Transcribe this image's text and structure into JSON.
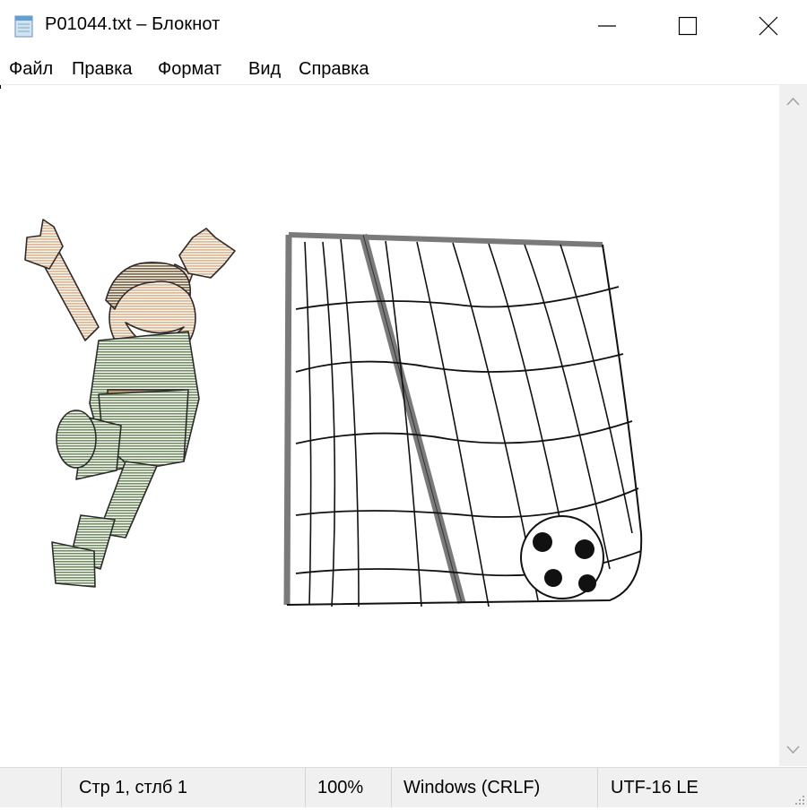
{
  "window": {
    "title": "P01044.txt – Блокнот",
    "icon": "notepad-icon",
    "controls": [
      "minimize-icon",
      "maximize-icon",
      "close-icon"
    ]
  },
  "menu": {
    "items": [
      "Файл",
      "Правка",
      "Формат",
      "Вид",
      "Справка"
    ]
  },
  "editor": {
    "content_description_icon": "ascii-art-soccer-player-and-goal"
  },
  "status": {
    "position": "Стр 1, стлб 1",
    "zoom": "100%",
    "line_endings": "Windows (CRLF)",
    "encoding": "UTF-16 LE"
  },
  "colors": {
    "uniform_green": "#7c9a6a",
    "skin": "#e9c3a0",
    "hair": "#8a6a4a",
    "goal_post": "#7a7a7a",
    "statusbar_bg": "#f0f0f0"
  }
}
